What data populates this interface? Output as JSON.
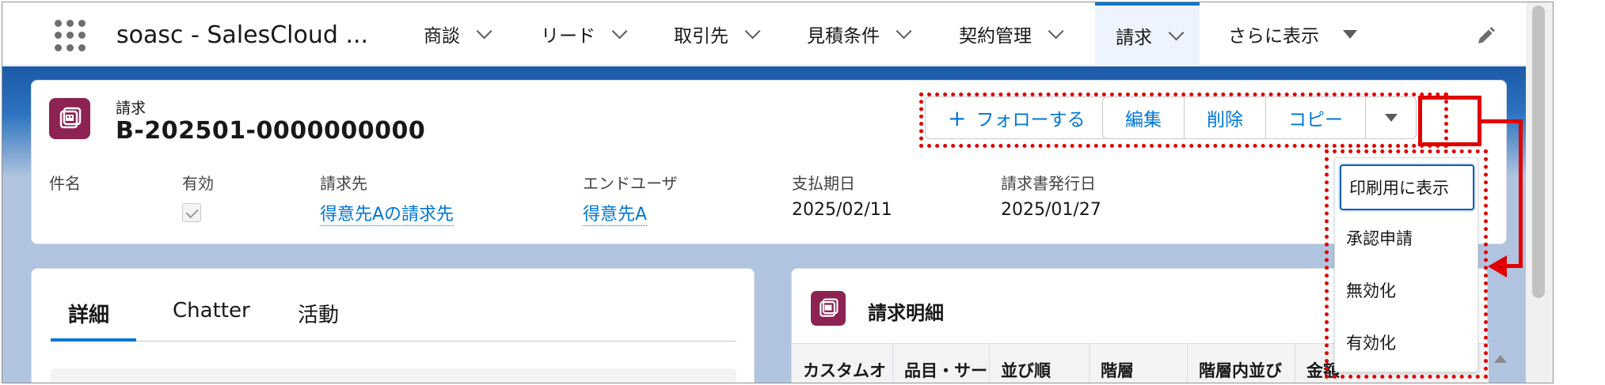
{
  "nav": {
    "app_name": "soasc - SalesCloud ...",
    "items": [
      {
        "label": "商談"
      },
      {
        "label": "リード"
      },
      {
        "label": "取引先"
      },
      {
        "label": "見積条件"
      },
      {
        "label": "契約管理"
      },
      {
        "label": "請求"
      },
      {
        "label": "さらに表示"
      }
    ]
  },
  "record": {
    "object_type": "請求",
    "title": "B-202501-0000000000"
  },
  "actions": {
    "follow": "フォローする",
    "edit": "編集",
    "delete": "削除",
    "copy": "コピー"
  },
  "fields": [
    {
      "label": "件名",
      "value": ""
    },
    {
      "label": "有効",
      "checked": true
    },
    {
      "label": "請求先",
      "value": "得意先Aの請求先"
    },
    {
      "label": "エンドユーザ",
      "value": "得意先A"
    },
    {
      "label": "支払期日",
      "value": "2025/02/11"
    },
    {
      "label": "請求書発行日",
      "value": "2025/01/27"
    }
  ],
  "tabs": [
    {
      "label": "詳細"
    },
    {
      "label": "Chatter"
    },
    {
      "label": "活動"
    }
  ],
  "related": {
    "title": "請求明細",
    "columns": [
      "カスタムオ",
      "品目・サー",
      "並び順",
      "階層",
      "階層内並び",
      "金額"
    ]
  },
  "menu": {
    "items": [
      "印刷用に表示",
      "承認申請",
      "無効化",
      "有効化"
    ]
  },
  "colors": {
    "accent": "#0176d3",
    "object_icon": "#8c2353",
    "annotation_red": "#e00000"
  }
}
